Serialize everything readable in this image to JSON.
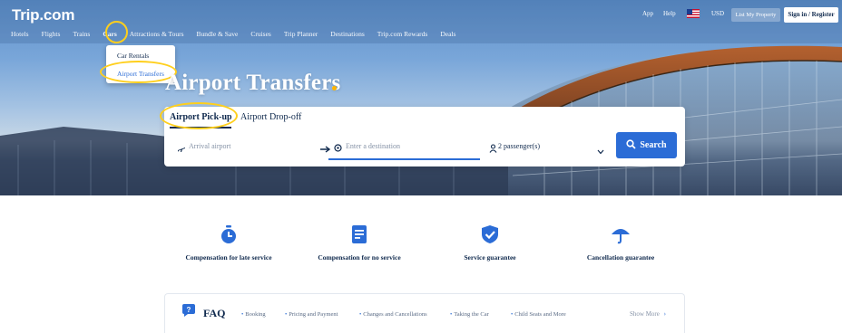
{
  "header": {
    "logo": "Trip.com",
    "nav": [
      "Hotels",
      "Flights",
      "Trains",
      "Cars",
      "Attractions & Tours",
      "Bundle & Save",
      "Cruises",
      "Trip Planner",
      "Destinations",
      "Trip.com Rewards",
      "Deals"
    ],
    "active_nav": "Cars",
    "utilities": {
      "app": "App",
      "help": "Help",
      "currency": "USD",
      "list_property": "List My Property",
      "sign_in": "Sign in / Register"
    }
  },
  "cars_dropdown": {
    "items": [
      "Car Rentals",
      "Airport Transfers"
    ],
    "selected": "Airport Transfers"
  },
  "hero": {
    "title": "Airport Transfers"
  },
  "search": {
    "tabs": [
      "Airport Pick-up",
      "Airport Drop-off"
    ],
    "active_tab": "Airport Pick-up",
    "arrival_placeholder": "Arrival airport",
    "destination_placeholder": "Enter a destination",
    "passengers": "2 passenger(s)",
    "search_button": "Search"
  },
  "features": [
    {
      "icon": "clock-icon",
      "label": "Compensation for late service"
    },
    {
      "icon": "document-icon",
      "label": "Compensation for no service"
    },
    {
      "icon": "shield-check-icon",
      "label": "Service guarantee"
    },
    {
      "icon": "umbrella-icon",
      "label": "Cancellation guarantee"
    }
  ],
  "faq": {
    "title": "FAQ",
    "links": [
      "Booking",
      "Pricing and Payment",
      "Changes and Cancellations",
      "Taking the Car",
      "Child Seats and More"
    ],
    "show_more": "Show More"
  },
  "colors": {
    "accent": "#2b6cd6",
    "highlight_ring": "#ffcf1c",
    "title_dot": "#ffb400",
    "text_dark": "#0f294d"
  }
}
